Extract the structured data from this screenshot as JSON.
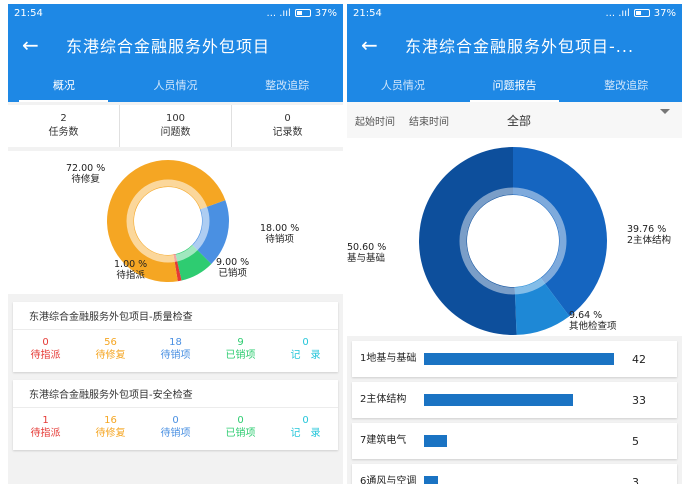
{
  "status_bar": {
    "time": "21:54",
    "signal_text": "... .ııl",
    "battery_percent": "37%"
  },
  "left": {
    "title": "东港综合金融服务外包项目",
    "tabs": [
      "概况",
      "人员情况",
      "整改追踪"
    ],
    "active_tab": 0,
    "stats": [
      {
        "value": "2",
        "label": "任务数"
      },
      {
        "value": "100",
        "label": "问题数"
      },
      {
        "value": "0",
        "label": "记录数"
      }
    ],
    "chart_data": {
      "type": "pie",
      "style": "donut",
      "slices": [
        {
          "name": "待修复",
          "percent": 72.0,
          "label": "72.00 %",
          "color": "#f5a623"
        },
        {
          "name": "待销项",
          "percent": 18.0,
          "label": "18.00 %",
          "color": "#4a90e2"
        },
        {
          "name": "已销项",
          "percent": 9.0,
          "label": "9.00 %",
          "color": "#2ecc71"
        },
        {
          "name": "待指派",
          "percent": 1.0,
          "label": "1.00 %",
          "color": "#e53935"
        }
      ]
    },
    "cards": [
      {
        "title": "东港综合金融服务外包项目-质量检查",
        "items": [
          {
            "value": "0",
            "label": "待指派",
            "color": "#e53935"
          },
          {
            "value": "56",
            "label": "待修复",
            "color": "#f5a623"
          },
          {
            "value": "18",
            "label": "待销项",
            "color": "#4a90e2"
          },
          {
            "value": "9",
            "label": "已销项",
            "color": "#2ecc71"
          },
          {
            "value": "0",
            "label": "记　录",
            "color": "#26c6da"
          }
        ]
      },
      {
        "title": "东港综合金融服务外包项目-安全检查",
        "items": [
          {
            "value": "1",
            "label": "待指派",
            "color": "#e53935"
          },
          {
            "value": "16",
            "label": "待修复",
            "color": "#f5a623"
          },
          {
            "value": "0",
            "label": "待销项",
            "color": "#4a90e2"
          },
          {
            "value": "0",
            "label": "已销项",
            "color": "#2ecc71"
          },
          {
            "value": "0",
            "label": "记　录",
            "color": "#26c6da"
          }
        ]
      }
    ]
  },
  "right": {
    "title": "东港综合金融服务外包项目-...",
    "tabs": [
      "人员情况",
      "问题报告",
      "整改追踪"
    ],
    "active_tab": 1,
    "filter": {
      "start_label": "起始时间",
      "end_label": "结束时间",
      "selected": "全部"
    },
    "chart_data": {
      "type": "pie",
      "style": "donut",
      "slices": [
        {
          "name": "2主体结构",
          "percent": 39.76,
          "label": "39.76 %",
          "color": "#1565c0"
        },
        {
          "name": "其他检查项",
          "percent": 9.64,
          "label": "9.64 %",
          "color": "#1e88d6"
        },
        {
          "name": "地基与基础",
          "percent": 50.6,
          "label": "50.60 %",
          "color": "#0d4f9c"
        }
      ],
      "labels": {
        "slice1": "2主体结构",
        "slice2": "其他检查项",
        "slice3": "基与基础"
      }
    },
    "bar_chart": {
      "type": "bar",
      "orientation": "horizontal",
      "categories": [
        "1地基与基础",
        "2主体结构",
        "7建筑电气",
        "6通风与空调"
      ],
      "values": [
        42,
        33,
        5,
        3
      ],
      "xlim": [
        0,
        42
      ],
      "color": "#1a73c3"
    }
  }
}
